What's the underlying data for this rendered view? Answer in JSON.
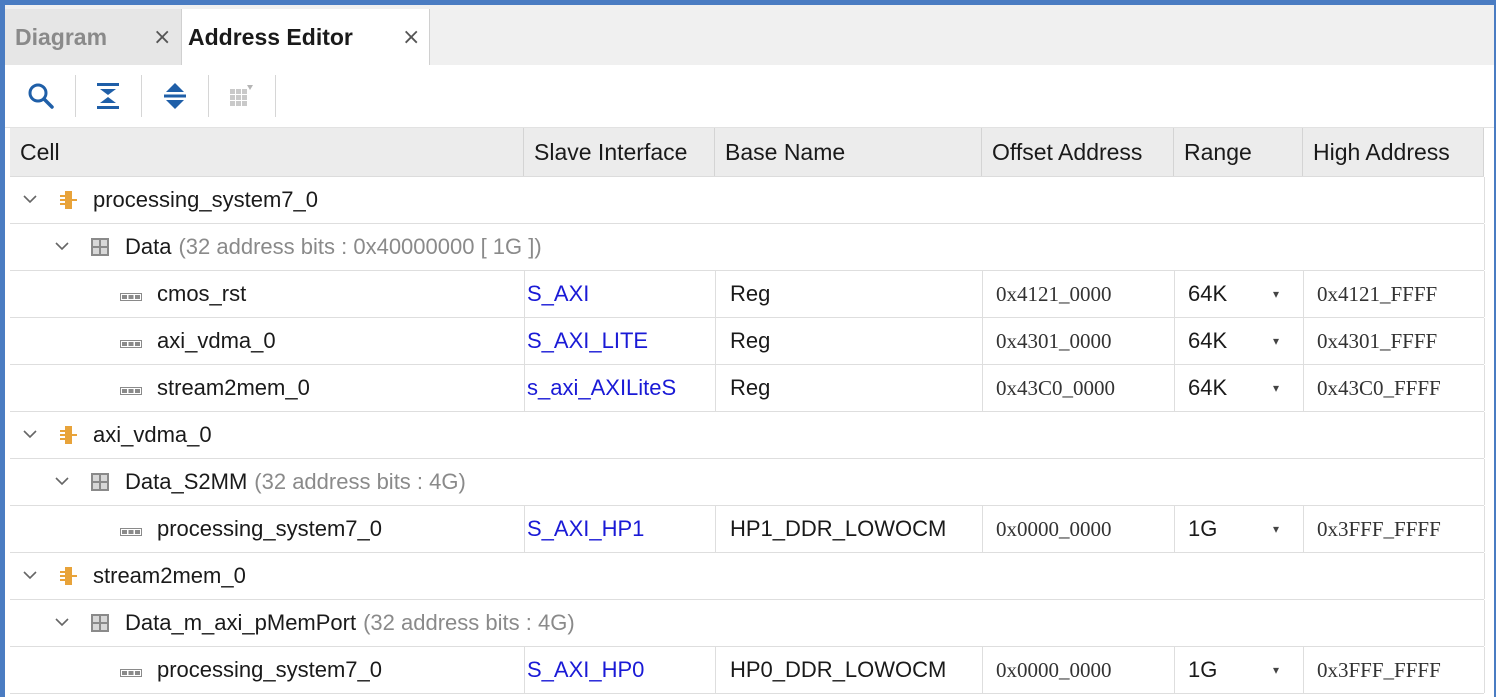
{
  "tabs": [
    {
      "label": "Diagram",
      "close": "×"
    },
    {
      "label": "Address Editor",
      "close": "×"
    }
  ],
  "toolbar": {
    "buttons": [
      "search-icon",
      "collapse-all-icon",
      "expand-all-icon",
      "auto-assign-icon"
    ]
  },
  "columns": [
    "Cell",
    "Slave Interface",
    "Base Name",
    "Offset Address",
    "Range",
    "High Address"
  ],
  "rows": [
    {
      "level": 0,
      "kind": "master",
      "cell": "processing_system7_0"
    },
    {
      "level": 1,
      "kind": "space",
      "cell": "Data",
      "note": "(32 address bits : 0x40000000 [ 1G ])"
    },
    {
      "level": 2,
      "kind": "seg",
      "cell": "cmos_rst",
      "iface": "S_AXI",
      "base": "Reg",
      "offset": "0x4121_0000",
      "range": "64K",
      "high": "0x4121_FFFF"
    },
    {
      "level": 2,
      "kind": "seg",
      "cell": "axi_vdma_0",
      "iface": "S_AXI_LITE",
      "base": "Reg",
      "offset": "0x4301_0000",
      "range": "64K",
      "high": "0x4301_FFFF"
    },
    {
      "level": 2,
      "kind": "seg",
      "cell": "stream2mem_0",
      "iface": "s_axi_AXILiteS",
      "base": "Reg",
      "offset": "0x43C0_0000",
      "range": "64K",
      "high": "0x43C0_FFFF"
    },
    {
      "level": 0,
      "kind": "master",
      "cell": "axi_vdma_0"
    },
    {
      "level": 1,
      "kind": "space",
      "cell": "Data_S2MM",
      "note": "(32 address bits : 4G)"
    },
    {
      "level": 2,
      "kind": "seg",
      "cell": "processing_system7_0",
      "iface": "S_AXI_HP1",
      "base": "HP1_DDR_LOWOCM",
      "offset": "0x0000_0000",
      "range": "1G",
      "high": "0x3FFF_FFFF"
    },
    {
      "level": 0,
      "kind": "master",
      "cell": "stream2mem_0"
    },
    {
      "level": 1,
      "kind": "space",
      "cell": "Data_m_axi_pMemPort",
      "note": "(32 address bits : 4G)"
    },
    {
      "level": 2,
      "kind": "seg",
      "cell": "processing_system7_0",
      "iface": "S_AXI_HP0",
      "base": "HP0_DDR_LOWOCM",
      "offset": "0x0000_0000",
      "range": "1G",
      "high": "0x3FFF_FFFF"
    }
  ],
  "colors": {
    "accent": "#4a7cc2",
    "link": "#1a1ad6",
    "master_icon": "#e8a33a"
  }
}
